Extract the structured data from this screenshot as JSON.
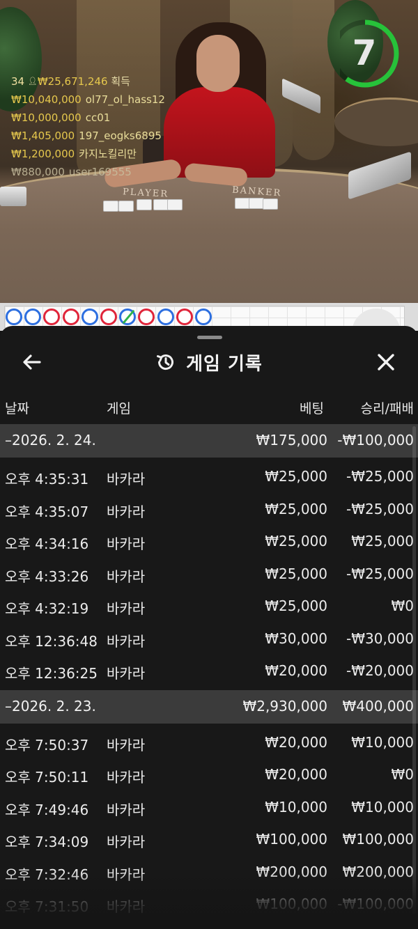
{
  "timer": {
    "countdown": "7",
    "remaining_fraction": 0.6
  },
  "winners": {
    "players_count": "34",
    "total_won": "₩25,671,246",
    "total_label": "획득",
    "rows": [
      {
        "amount": "₩10,040,000",
        "user": "ol77_ol_hass12"
      },
      {
        "amount": "₩10,000,000",
        "user": "cc01"
      },
      {
        "amount": "₩1,405,000",
        "user": "197_eogks6895"
      },
      {
        "amount": "₩1,200,000",
        "user": "카지노킬리만"
      },
      {
        "amount": "₩880,000",
        "user": "user169555"
      }
    ]
  },
  "table_labels": {
    "player": "PLAYER",
    "banker": "BANKER"
  },
  "roadmap": {
    "beads": [
      "b",
      "b",
      "r",
      "r",
      "b",
      "r",
      "g",
      "r",
      "b",
      "r",
      "b"
    ]
  },
  "sheet": {
    "back_icon": "arrow-left-icon",
    "history_icon": "history-clock-icon",
    "title": "게임 기록",
    "close_icon": "close-icon",
    "columns": {
      "date": "날짜",
      "game": "게임",
      "bet": "베팅",
      "result": "승리/패배"
    }
  },
  "history": [
    {
      "date": "–2026. 2. 24.",
      "total_bet": "₩175,000",
      "total_result": "-₩100,000",
      "rows": [
        {
          "time": "오후 4:35:31",
          "game": "바카라",
          "bet": "₩25,000",
          "result": "-₩25,000"
        },
        {
          "time": "오후 4:35:07",
          "game": "바카라",
          "bet": "₩25,000",
          "result": "-₩25,000"
        },
        {
          "time": "오후 4:34:16",
          "game": "바카라",
          "bet": "₩25,000",
          "result": "₩25,000"
        },
        {
          "time": "오후 4:33:26",
          "game": "바카라",
          "bet": "₩25,000",
          "result": "-₩25,000"
        },
        {
          "time": "오후 4:32:19",
          "game": "바카라",
          "bet": "₩25,000",
          "result": "₩0"
        },
        {
          "time": "오후 12:36:48",
          "game": "바카라",
          "bet": "₩30,000",
          "result": "-₩30,000"
        },
        {
          "time": "오후 12:36:25",
          "game": "바카라",
          "bet": "₩20,000",
          "result": "-₩20,000"
        }
      ]
    },
    {
      "date": "–2026. 2. 23.",
      "total_bet": "₩2,930,000",
      "total_result": "₩400,000",
      "rows": [
        {
          "time": "오후 7:50:37",
          "game": "바카라",
          "bet": "₩20,000",
          "result": "₩10,000"
        },
        {
          "time": "오후 7:50:11",
          "game": "바카라",
          "bet": "₩20,000",
          "result": "₩0"
        },
        {
          "time": "오후 7:49:46",
          "game": "바카라",
          "bet": "₩10,000",
          "result": "₩10,000"
        },
        {
          "time": "오후 7:34:09",
          "game": "바카라",
          "bet": "₩100,000",
          "result": "₩100,000"
        },
        {
          "time": "오후 7:32:46",
          "game": "바카라",
          "bet": "₩200,000",
          "result": "₩200,000"
        },
        {
          "time": "오후 7:31:50",
          "game": "바카라",
          "bet": "₩100,000",
          "result": "-₩100,000"
        }
      ]
    }
  ]
}
